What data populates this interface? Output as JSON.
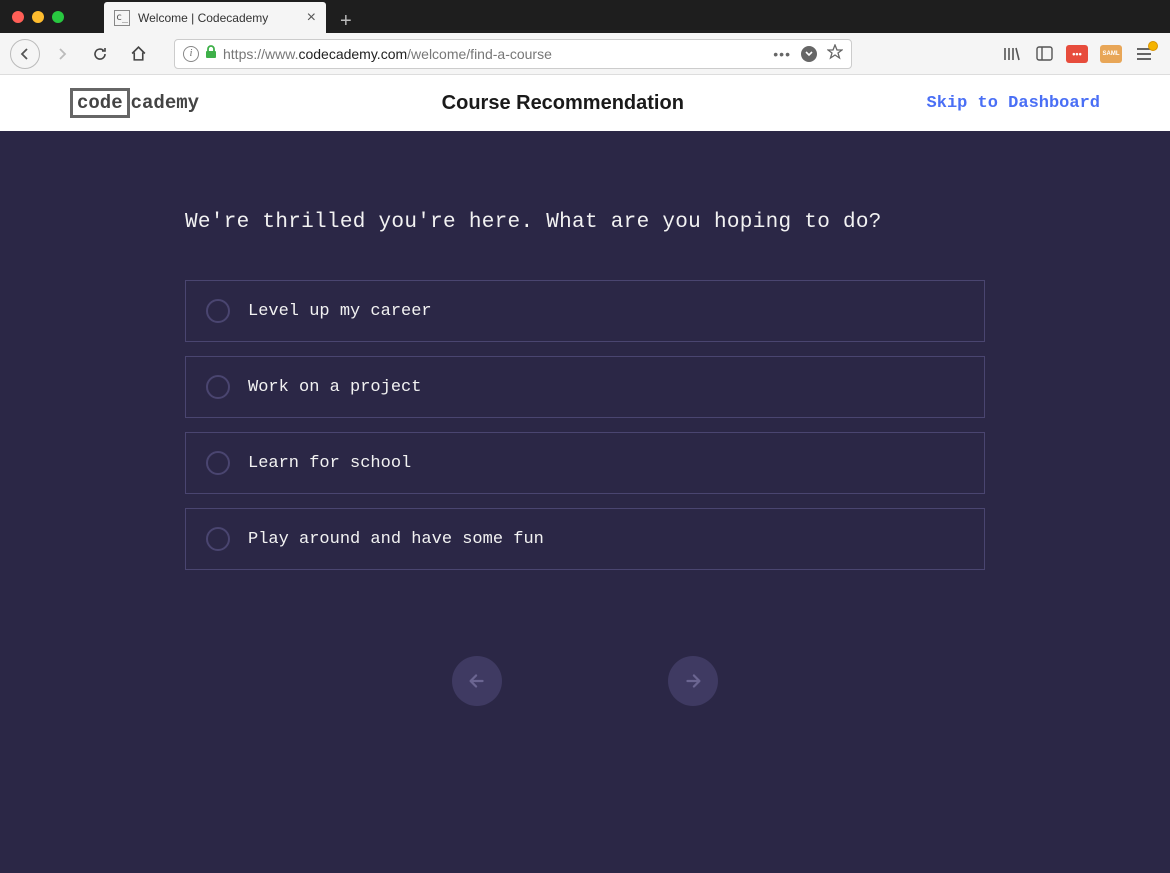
{
  "browser": {
    "tab_title": "Welcome | Codecademy",
    "url_prefix": "https://www.",
    "url_domain": "codecademy.com",
    "url_path": "/welcome/find-a-course"
  },
  "header": {
    "logo_boxed": "code",
    "logo_rest": "cademy",
    "title": "Course Recommendation",
    "skip_link": "Skip to Dashboard"
  },
  "onboarding": {
    "question": "We're thrilled you're here. What are you hoping to do?",
    "options": [
      {
        "label": "Level up my career"
      },
      {
        "label": "Work on a project"
      },
      {
        "label": "Learn for school"
      },
      {
        "label": "Play around and have some fun"
      }
    ]
  }
}
